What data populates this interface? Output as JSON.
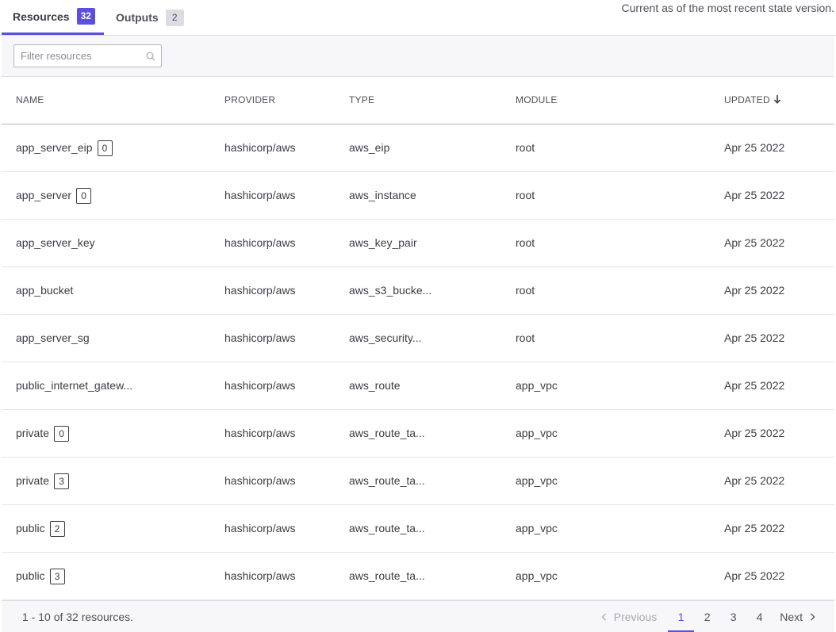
{
  "tabs": [
    {
      "label": "Resources",
      "count": "32"
    },
    {
      "label": "Outputs",
      "count": "2"
    }
  ],
  "state_note": "Current as of the most recent state version.",
  "filter": {
    "placeholder": "Filter resources",
    "icon": "search-icon"
  },
  "table": {
    "headers": {
      "name": "NAME",
      "provider": "PROVIDER",
      "type": "TYPE",
      "module": "MODULE",
      "updated": "UPDATED"
    },
    "sort_icon": "arrow-down-icon",
    "rows": [
      {
        "name": "app_server_eip",
        "index": "0",
        "provider": "hashicorp/aws",
        "type": "aws_eip",
        "module": "root",
        "updated": "Apr 25 2022"
      },
      {
        "name": "app_server",
        "index": "0",
        "provider": "hashicorp/aws",
        "type": "aws_instance",
        "module": "root",
        "updated": "Apr 25 2022"
      },
      {
        "name": "app_server_key",
        "index": null,
        "provider": "hashicorp/aws",
        "type": "aws_key_pair",
        "module": "root",
        "updated": "Apr 25 2022"
      },
      {
        "name": "app_bucket",
        "index": null,
        "provider": "hashicorp/aws",
        "type": "aws_s3_bucke...",
        "module": "root",
        "updated": "Apr 25 2022"
      },
      {
        "name": "app_server_sg",
        "index": null,
        "provider": "hashicorp/aws",
        "type": "aws_security...",
        "module": "root",
        "updated": "Apr 25 2022"
      },
      {
        "name": "public_internet_gatew...",
        "index": null,
        "provider": "hashicorp/aws",
        "type": "aws_route",
        "module": "app_vpc",
        "updated": "Apr 25 2022"
      },
      {
        "name": "private",
        "index": "0",
        "provider": "hashicorp/aws",
        "type": "aws_route_ta...",
        "module": "app_vpc",
        "updated": "Apr 25 2022"
      },
      {
        "name": "private",
        "index": "3",
        "provider": "hashicorp/aws",
        "type": "aws_route_ta...",
        "module": "app_vpc",
        "updated": "Apr 25 2022"
      },
      {
        "name": "public",
        "index": "2",
        "provider": "hashicorp/aws",
        "type": "aws_route_ta...",
        "module": "app_vpc",
        "updated": "Apr 25 2022"
      },
      {
        "name": "public",
        "index": "3",
        "provider": "hashicorp/aws",
        "type": "aws_route_ta...",
        "module": "app_vpc",
        "updated": "Apr 25 2022"
      }
    ]
  },
  "footer": {
    "summary": "1 - 10 of 32 resources.",
    "previous_label": "Previous",
    "next_label": "Next",
    "pages": [
      "1",
      "2",
      "3",
      "4"
    ],
    "current_page": "1"
  },
  "colors": {
    "accent": "#5c4ee5",
    "border": "#dcdce3",
    "muted_bg": "#f7f7f9"
  }
}
